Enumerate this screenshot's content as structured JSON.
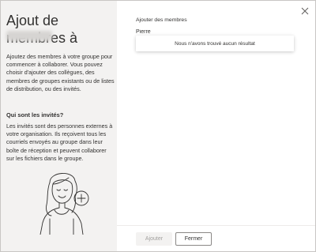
{
  "panel": {
    "title": "Ajout de membres à",
    "intro": "Ajoutez des membres à votre groupe pour commencer à collaborer. Vous pouvez choisir d'ajouter des collègues, des membres de groupes existants ou de listes de distribution, ou des invités.",
    "invite_heading": "Qui sont les invités?",
    "invite_text": "Les invités sont des personnes externes à votre organisation. Ils reçoivent tous les courriels envoyés au groupe dans leur boîte de réception et peuvent collaborer sur les fichiers dans le groupe."
  },
  "form": {
    "field_label": "Ajouter des membres",
    "search_value": "Pierre",
    "no_results": "Nous n'avons trouvé aucun résultat"
  },
  "footer": {
    "add_label": "Ajouter",
    "close_label": "Fermer"
  },
  "icons": {
    "close": "close-icon",
    "illustration": "person-add-illustration"
  },
  "colors": {
    "left_pane_bg": "#f3f2f1",
    "disabled_button_bg": "#f3f2f1",
    "text": "#323130"
  }
}
